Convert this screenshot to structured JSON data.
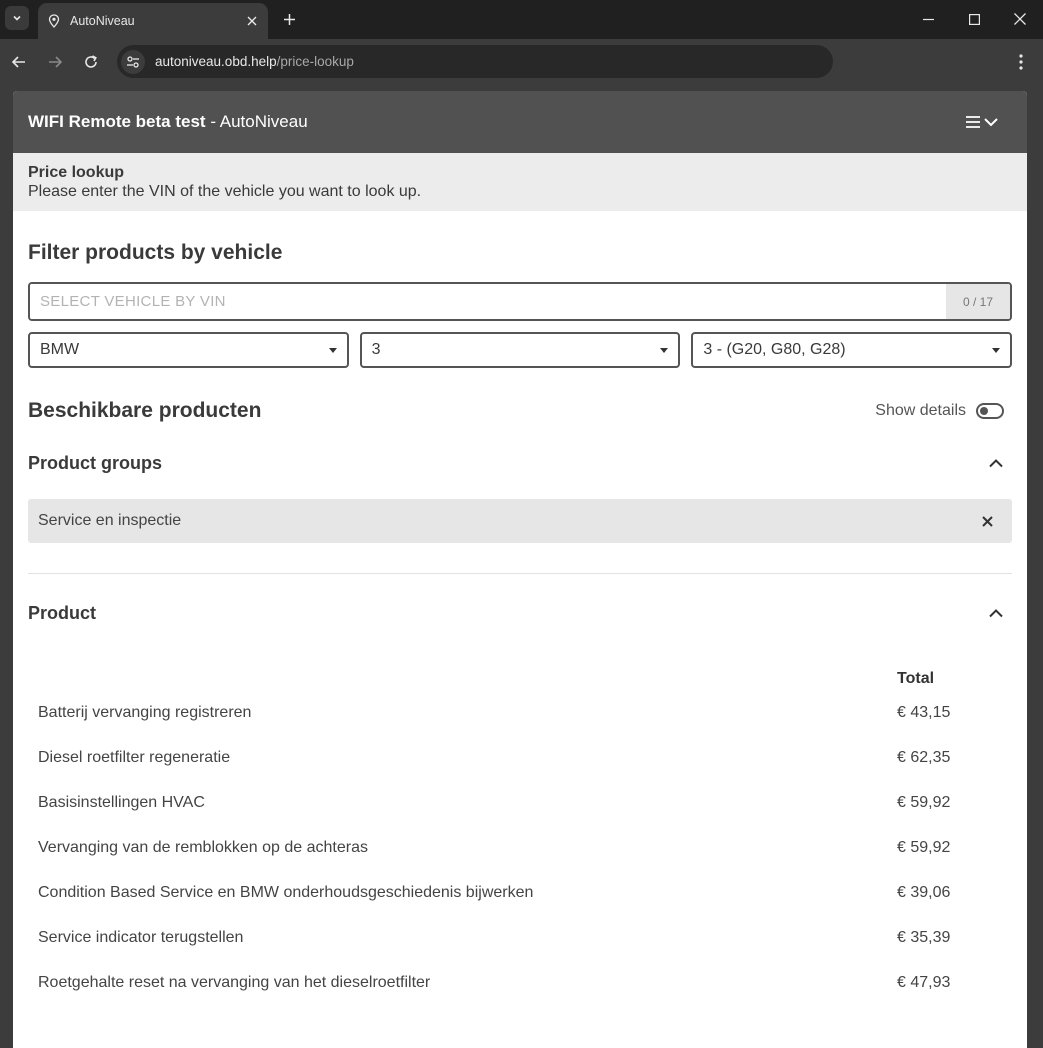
{
  "browser": {
    "tab_title": "AutoNiveau",
    "url_host": "autoniveau.obd.help",
    "url_path": "/price-lookup"
  },
  "header": {
    "title_strong": "WIFI Remote beta test",
    "title_rest": " - AutoNiveau"
  },
  "subheader": {
    "title": "Price lookup",
    "text": "Please enter the VIN of the vehicle you want to look up."
  },
  "filter": {
    "title": "Filter products by vehicle",
    "vin_placeholder": "SELECT VEHICLE BY VIN",
    "vin_count": "0 / 17",
    "make": "BMW",
    "series": "3",
    "model": "3 - (G20, G80, G28)"
  },
  "available": {
    "title": "Beschikbare producten",
    "show_details_label": "Show details",
    "show_details_on": false
  },
  "product_groups": {
    "title": "Product groups",
    "selected": "Service en inspectie"
  },
  "products": {
    "title": "Product",
    "total_header": "Total",
    "rows": [
      {
        "name": "Batterij vervanging registreren",
        "price": "€ 43,15"
      },
      {
        "name": "Diesel roetfilter regeneratie",
        "price": "€ 62,35"
      },
      {
        "name": "Basisinstellingen HVAC",
        "price": "€ 59,92"
      },
      {
        "name": "Vervanging van de remblokken op de achteras",
        "price": "€ 59,92"
      },
      {
        "name": "Condition Based Service en BMW onderhoudsgeschiedenis bijwerken",
        "price": "€ 39,06"
      },
      {
        "name": "Service indicator terugstellen",
        "price": "€ 35,39"
      },
      {
        "name": "Roetgehalte reset na vervanging van het dieselroetfilter",
        "price": "€ 47,93"
      }
    ]
  }
}
